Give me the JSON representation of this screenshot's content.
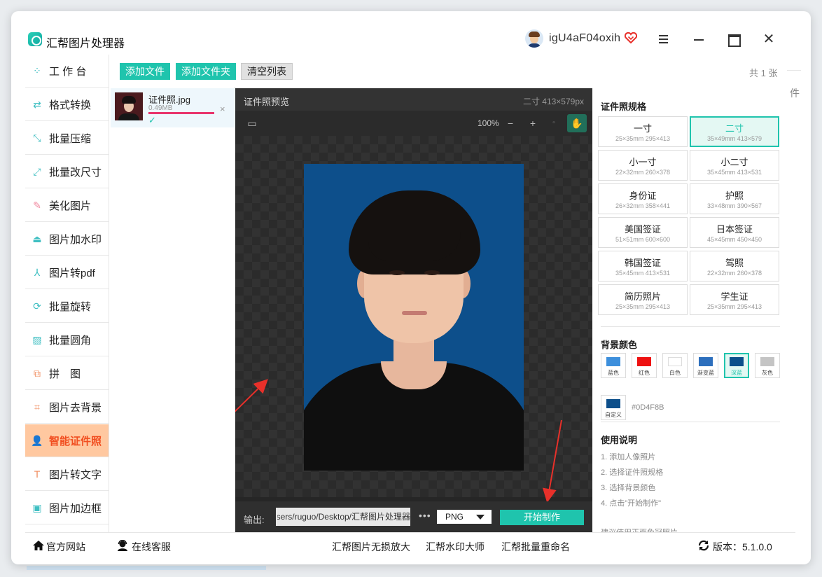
{
  "app": {
    "title": "汇帮图片处理器",
    "username": "igU4aF04oxih"
  },
  "sidebar": {
    "items": [
      {
        "label": "工 作 台",
        "icon": "grid-icon",
        "glyph": "⁘"
      },
      {
        "label": "格式转换",
        "icon": "convert-icon",
        "glyph": "⇄"
      },
      {
        "label": "批量压缩",
        "icon": "compress-icon",
        "glyph": "⤡"
      },
      {
        "label": "批量改尺寸",
        "icon": "resize-icon",
        "glyph": "⤢"
      },
      {
        "label": "美化图片",
        "icon": "beautify-icon",
        "glyph": "✎"
      },
      {
        "label": "图片加水印",
        "icon": "watermark-icon",
        "glyph": "⏏"
      },
      {
        "label": "图片转pdf",
        "icon": "pdf-icon",
        "glyph": "⅄"
      },
      {
        "label": "批量旋转",
        "icon": "rotate-icon",
        "glyph": "⟳"
      },
      {
        "label": "批量圆角",
        "icon": "round-corner-icon",
        "glyph": "▨"
      },
      {
        "label": "拼　图",
        "icon": "puzzle-icon",
        "glyph": "⧉"
      },
      {
        "label": "图片去背景",
        "icon": "crop-icon",
        "glyph": "⌗"
      },
      {
        "label": "智能证件照",
        "icon": "person-icon",
        "glyph": "👤"
      },
      {
        "label": "图片转文字",
        "icon": "text-icon",
        "glyph": "T"
      },
      {
        "label": "图片加边框",
        "icon": "frame-icon",
        "glyph": "▣"
      }
    ],
    "active_index": 11
  },
  "toolbar": {
    "add_file": "添加文件",
    "add_folder": "添加文件夹",
    "clear_list": "清空列表",
    "count": "共 1 张",
    "right_cut": "件"
  },
  "file": {
    "name": "证件照.jpg",
    "size": "0.49MB",
    "progress": 1.0,
    "status": "✓",
    "remove": "×"
  },
  "preview": {
    "title": "证件照预览",
    "size_info": "二寸 413×579px",
    "zoom": "100%",
    "zoom_out": "−",
    "zoom_in": "+",
    "output_label": "输出:",
    "output_path": "C:/Users/ruguo/Desktop/汇帮图片处理器",
    "more": "•••",
    "format": "PNG",
    "start_button": "开始制作"
  },
  "spec": {
    "title": "证件照规格",
    "items": [
      {
        "name": "一寸",
        "dims": "25×35mm 295×413"
      },
      {
        "name": "二寸",
        "dims": "35×49mm 413×579"
      },
      {
        "name": "小一寸",
        "dims": "22×32mm 260×378"
      },
      {
        "name": "小二寸",
        "dims": "35×45mm 413×531"
      },
      {
        "name": "身份证",
        "dims": "26×32mm 358×441"
      },
      {
        "name": "护照",
        "dims": "33×48mm 390×567"
      },
      {
        "name": "美国签证",
        "dims": "51×51mm 600×600"
      },
      {
        "name": "日本签证",
        "dims": "45×45mm 450×450"
      },
      {
        "name": "韩国签证",
        "dims": "35×45mm 413×531"
      },
      {
        "name": "驾照",
        "dims": "22×32mm 260×378"
      },
      {
        "name": "简历照片",
        "dims": "25×35mm 295×413"
      },
      {
        "name": "学生证",
        "dims": "25×35mm 295×413"
      }
    ],
    "selected_index": 1
  },
  "background": {
    "title": "背景颜色",
    "colors": [
      {
        "label": "蓝色",
        "color": "#3d8fdc"
      },
      {
        "label": "红色",
        "color": "#ee1111"
      },
      {
        "label": "白色",
        "color": "#ffffff"
      },
      {
        "label": "渐变蓝",
        "color": "#2d6fbd"
      },
      {
        "label": "深蓝",
        "color": "#0d4f8b"
      },
      {
        "label": "灰色",
        "color": "#c4c4c4"
      },
      {
        "label": "自定义",
        "color": "#0d4f8b"
      }
    ],
    "selected_index": 4,
    "hex": "#0D4F8B"
  },
  "usage": {
    "title": "使用说明",
    "steps": [
      "1. 添加人像照片",
      "2. 选择证件照规格",
      "3. 选择背景颜色",
      "4. 点击\"开始制作\""
    ],
    "tip": "建议使用正面免冠照片"
  },
  "footer": {
    "website": "官方网站",
    "support": "在线客服",
    "link1": "汇帮图片无损放大",
    "link2": "汇帮水印大师",
    "link3": "汇帮批量重命名",
    "version": "版本：5.1.0.0"
  },
  "colors": {
    "accent": "#1fc4ad",
    "active_bg": "#ffc8a0",
    "active_text": "#f14d1f",
    "arrow": "#e8302a"
  }
}
